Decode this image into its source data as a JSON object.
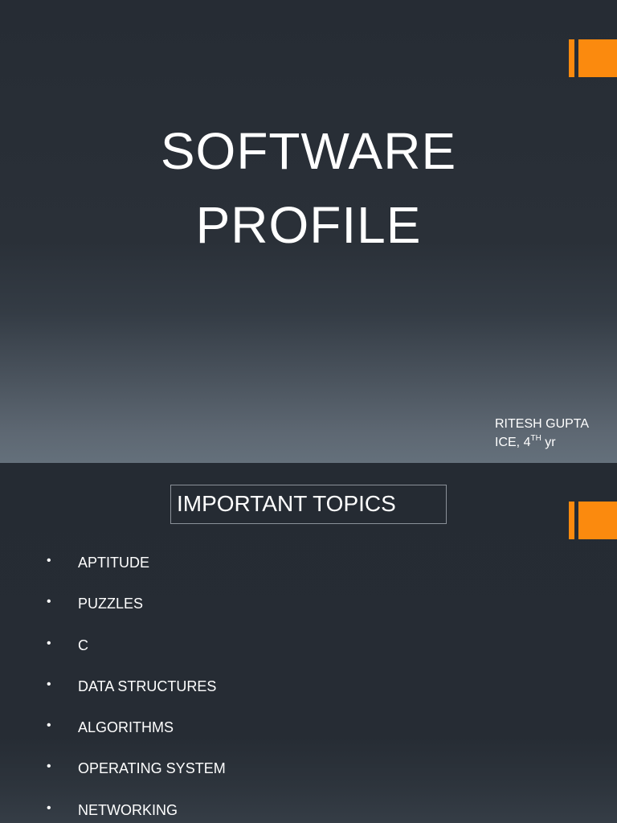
{
  "slide1": {
    "title_line1": "SOFTWARE",
    "title_line2": "PROFILE",
    "author_name": "RITESH GUPTA",
    "author_detail_prefix": "ICE, 4",
    "author_detail_sup": "TH",
    "author_detail_suffix": " yr"
  },
  "slide2": {
    "heading": "IMPORTANT TOPICS",
    "bullet_char": "•",
    "topics": [
      "APTITUDE",
      "PUZZLES",
      "C",
      "DATA STRUCTURES",
      "ALGORITHMS",
      "OPERATING SYSTEM",
      "NETWORKING"
    ]
  },
  "colors": {
    "background": "#262c34",
    "accent": "#fb8a0e",
    "text": "#ffffff"
  }
}
